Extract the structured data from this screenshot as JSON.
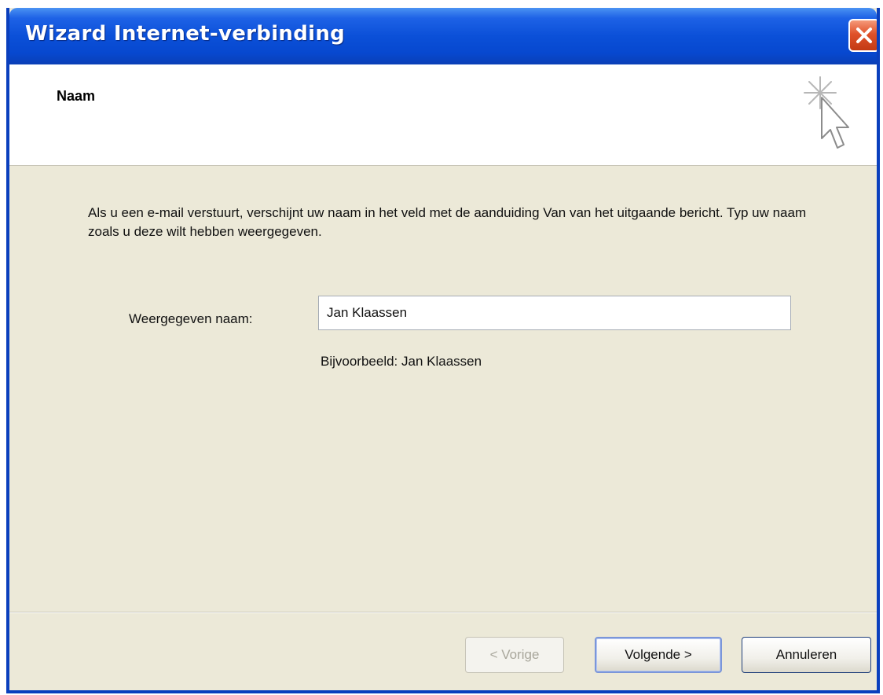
{
  "window": {
    "title": "Wizard Internet-verbinding"
  },
  "header": {
    "title": "Naam"
  },
  "content": {
    "intro": "Als u een e-mail verstuurt, verschijnt uw naam in het veld met de aanduiding Van van het uitgaande bericht. Typ uw naam zoals u deze wilt hebben weergegeven.",
    "field_label": "Weergegeven naam:",
    "field_value": "Jan Klaassen",
    "example": "Bijvoorbeeld: Jan Klaassen"
  },
  "buttons": {
    "back": "< Vorige",
    "next": "Volgende >",
    "cancel": "Annuleren"
  },
  "icons": {
    "close": "close-icon",
    "wizard": "wizard-cursor-icon"
  },
  "colors": {
    "titlebar": "#0b50d8",
    "close": "#e0522a",
    "dialog": "#ece9d8"
  }
}
